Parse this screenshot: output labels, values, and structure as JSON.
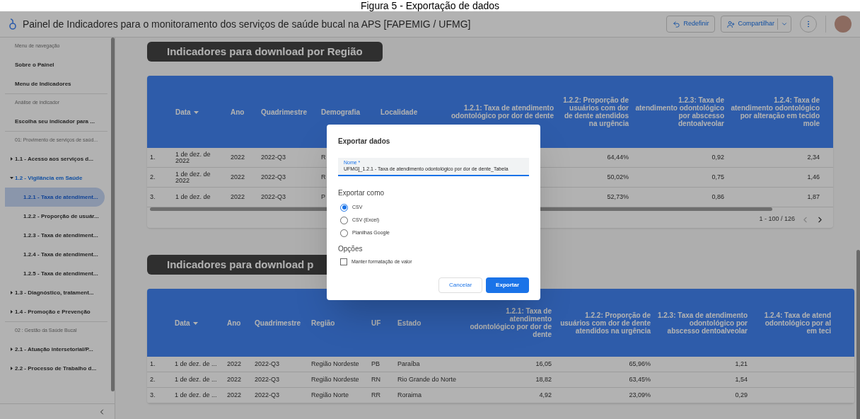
{
  "caption": "Figura 5 - Exportação de dados",
  "topbar": {
    "title": "Painel de Indicadores para o monitoramento dos serviços de saúde bucal na APS [FAPEMIG / UFMG]",
    "buttons": [
      {
        "kind": "reset",
        "label": "Redefinir"
      },
      {
        "kind": "share",
        "label": "Compartilhar"
      }
    ]
  },
  "sidebar": {
    "sections": [
      {
        "header": "Menu de navegação",
        "items": [
          {
            "label": "Sobre o Painel",
            "selected": false
          },
          {
            "label": "Menu de Indicadores",
            "selected": false
          }
        ]
      },
      {
        "header": "Análise de indicador",
        "items": [
          {
            "label": "Escolha seu indicador para ...",
            "selected": false
          }
        ]
      },
      {
        "header": "01: Provimento de serviços de saúd...",
        "items": [
          {
            "label": "1.1 - Acesso aos serviços d...",
            "selected": false,
            "expanded": false
          },
          {
            "label": "1.2 - Vigilância em Saúde",
            "selected": false,
            "expanded": true,
            "children": [
              {
                "label": "1.2.1 - Taxa de atendiment...",
                "selected": true
              },
              {
                "label": "1.2.2 - Proporção de usuár...",
                "selected": false
              },
              {
                "label": "1.2.3 - Taxa de atendiment...",
                "selected": false
              },
              {
                "label": "1.2.4 - Taxa de atendiment...",
                "selected": false
              },
              {
                "label": "1.2.5 - Taxa de atendiment...",
                "selected": false
              }
            ]
          },
          {
            "label": "1.3 - Diagnóstico, tratament...",
            "selected": false,
            "expanded": false
          },
          {
            "label": "1.4 - Promoção e Prevenção",
            "selected": false,
            "expanded": false
          }
        ]
      },
      {
        "header": "02 : Gestão da Saúde Bucal",
        "items": [
          {
            "label": "2.1 - Atuação intersetorial/P...",
            "selected": false,
            "expanded": false
          },
          {
            "label": "2.2 - Processo de Trabalho d...",
            "selected": false,
            "expanded": false
          }
        ]
      }
    ]
  },
  "tables": [
    {
      "title": "Indicadores para download por Região",
      "columns": [
        {
          "kind": "index"
        },
        {
          "kind": "text",
          "label": "Data",
          "sorted": true
        },
        {
          "kind": "text",
          "label": "Ano",
          "sorted": false
        },
        {
          "kind": "text",
          "label": "Quadrimestre",
          "sorted": false
        },
        {
          "kind": "text",
          "label": "Demografia",
          "sorted": false
        },
        {
          "kind": "text",
          "label": "Localidade",
          "sorted": false
        },
        {
          "kind": "number",
          "label": "1.2.1: Taxa de atendimento odontológico por dor de dente",
          "sorted": false
        },
        {
          "kind": "number",
          "label": "1.2.2: Proporção de usuários com dor de dente atendidos na urgência",
          "sorted": false
        },
        {
          "kind": "number",
          "label": "1.2.3: Taxa de atendimento odontológico por abscesso dentoalveolar",
          "sorted": false
        },
        {
          "kind": "number",
          "label": "1.2.4: Taxa de atendimento odontológico por alteração em tecido mole",
          "sorted": false
        }
      ],
      "rows": [
        {
          "cells": [
            "1.",
            "1 de dez. de 2022",
            "2022",
            "2022-Q3",
            "R",
            null,
            null,
            "64,44%",
            "0,92",
            "2,34"
          ]
        },
        {
          "cells": [
            "2.",
            "1 de dez. de 2022",
            "2022",
            "2022-Q3",
            "R",
            null,
            null,
            "50,02%",
            "0,75",
            "1,46"
          ]
        },
        {
          "cells": [
            "3.",
            "1 de dez. de",
            "2022",
            "2022-Q3",
            "P",
            null,
            null,
            "52,73%",
            "0,86",
            "1,87"
          ]
        }
      ],
      "pagination": "1 - 100 / 126"
    },
    {
      "title": "Indicadores para download p",
      "columns": [
        {
          "kind": "index"
        },
        {
          "kind": "text",
          "label": "Data",
          "sorted": true
        },
        {
          "kind": "text",
          "label": "Ano",
          "sorted": false
        },
        {
          "kind": "text",
          "label": "Quadrimestre",
          "sorted": false
        },
        {
          "kind": "text",
          "label": "Região",
          "sorted": false
        },
        {
          "kind": "text",
          "label": "UF",
          "sorted": false
        },
        {
          "kind": "text",
          "label": "Estado",
          "sorted": false
        },
        {
          "kind": "number",
          "label": "1.2.1: Taxa de atendimento odontológico por dor de dente",
          "sorted": false
        },
        {
          "kind": "number",
          "label": "1.2.2: Proporção de usuários com dor de dente atendidos na urgência",
          "sorted": false
        },
        {
          "kind": "number",
          "label": "1.2.3: Taxa de atendimento odontológico por abscesso dentoalveolar",
          "sorted": false
        },
        {
          "kind": "number",
          "label": "1.2.4: Taxa de atend odontológico por al em teci",
          "sorted": false
        }
      ],
      "rows": [
        {
          "cells": [
            "1.",
            "1 de dez. de ...",
            "2022",
            "2022-Q3",
            "Região Nordeste",
            "PB",
            "Paraíba",
            "16,05",
            "65,96%",
            "1,21",
            null
          ]
        },
        {
          "cells": [
            "2.",
            "1 de dez. de ...",
            "2022",
            "2022-Q3",
            "Região Nordeste",
            "RN",
            "Rio Grande do Norte",
            "18,82",
            "63,45%",
            "1,54",
            null
          ]
        },
        {
          "cells": [
            "3.",
            "1 de dez. de ...",
            "2022",
            "2022-Q3",
            "Região Norte",
            "RR",
            "Roraima",
            "4,92",
            "23,09%",
            "0,29",
            null
          ]
        }
      ]
    }
  ],
  "dialog": {
    "title": "Exportar dados",
    "field": {
      "label": "Nome *",
      "value": "UFMG]_1.2.1 - Taxa de atendimento odontológico por dor de dente_Tabela"
    },
    "format_heading": "Exportar como",
    "formats": [
      {
        "label": "CSV",
        "selected": true
      },
      {
        "label": "CSV (Excel)",
        "selected": false
      },
      {
        "label": "Planilhas Google",
        "selected": false
      }
    ],
    "options_heading": "Opções",
    "options": [
      {
        "label": "Manter formatação de valor",
        "checked": false
      }
    ],
    "buttons": [
      {
        "kind": "secondary",
        "label": "Cancelar"
      },
      {
        "kind": "primary",
        "label": "Exportar"
      }
    ]
  }
}
